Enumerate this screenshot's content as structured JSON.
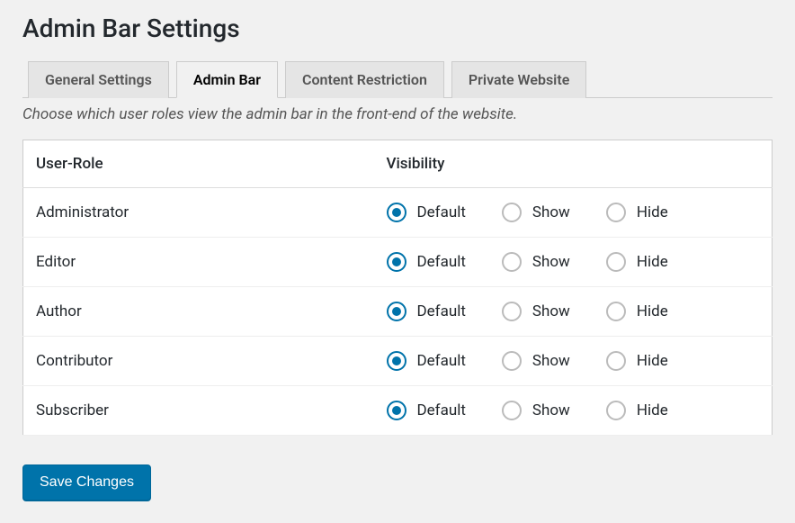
{
  "page_title": "Admin Bar Settings",
  "tabs": [
    {
      "label": "General Settings",
      "active": false
    },
    {
      "label": "Admin Bar",
      "active": true
    },
    {
      "label": "Content Restriction",
      "active": false
    },
    {
      "label": "Private Website",
      "active": false
    }
  ],
  "description": "Choose which user roles view the admin bar in the front-end of the website.",
  "table": {
    "headers": {
      "role": "User-Role",
      "visibility": "Visibility"
    },
    "options": {
      "default": "Default",
      "show": "Show",
      "hide": "Hide"
    },
    "roles": [
      {
        "name": "Administrator",
        "selected": "default"
      },
      {
        "name": "Editor",
        "selected": "default"
      },
      {
        "name": "Author",
        "selected": "default"
      },
      {
        "name": "Contributor",
        "selected": "default"
      },
      {
        "name": "Subscriber",
        "selected": "default"
      }
    ]
  },
  "save_button_label": "Save Changes"
}
